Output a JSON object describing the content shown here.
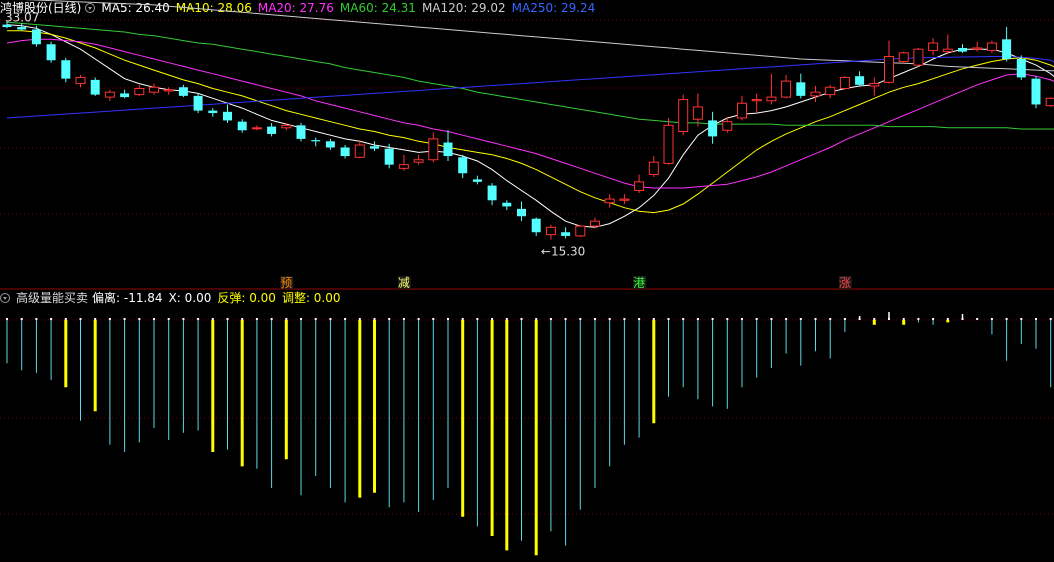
{
  "header": {
    "title": "鸿博股份(日线)",
    "ma": [
      {
        "label": "MA5: 26.40",
        "color": "#ffffff"
      },
      {
        "label": "MA10: 28.06",
        "color": "#ffff00"
      },
      {
        "label": "MA20: 27.76",
        "color": "#ff33ff"
      },
      {
        "label": "MA60: 24.31",
        "color": "#33cc33"
      },
      {
        "label": "MA120: 29.02",
        "color": "#cccccc"
      },
      {
        "label": "MA250: 29.24",
        "color": "#3333ff"
      }
    ]
  },
  "indicator": {
    "title": "高级量能买卖",
    "items": [
      {
        "label": "偏离: -11.84",
        "color": "#ffffff"
      },
      {
        "label": "X: 0.00",
        "color": "#ffffff"
      },
      {
        "label": "反弹: 0.00",
        "color": "#ffff00"
      },
      {
        "label": "调整: 0.00",
        "color": "#ffff00"
      }
    ]
  },
  "signals": [
    {
      "label": "预",
      "index": 19,
      "color": "#ff8800"
    },
    {
      "label": "减",
      "index": 27,
      "color": "#ffff66"
    },
    {
      "label": "港",
      "index": 43,
      "color": "#33ff33"
    },
    {
      "label": "涨",
      "index": 57,
      "color": "#ff4444"
    }
  ],
  "chart_data": {
    "type": "candlestick",
    "price_range": [
      12.5,
      33.5
    ],
    "annotations": [
      {
        "text": "33.07",
        "index": 0,
        "value": 33.07
      },
      {
        "text": "←15.30",
        "index": 37,
        "value": 15.3
      }
    ],
    "candles": [
      [
        32.8,
        33.07,
        32.5,
        32.6
      ],
      [
        32.6,
        32.9,
        32.3,
        32.4
      ],
      [
        32.4,
        32.7,
        31.0,
        31.2
      ],
      [
        31.2,
        31.4,
        29.7,
        29.9
      ],
      [
        29.9,
        30.1,
        28.1,
        28.4
      ],
      [
        28.0,
        28.7,
        27.7,
        28.5
      ],
      [
        28.3,
        28.5,
        27.0,
        27.1
      ],
      [
        26.9,
        27.5,
        26.6,
        27.3
      ],
      [
        27.2,
        27.5,
        26.8,
        26.9
      ],
      [
        27.1,
        27.9,
        27.0,
        27.6
      ],
      [
        27.3,
        28.0,
        27.1,
        27.7
      ],
      [
        27.4,
        27.7,
        27.1,
        27.5
      ],
      [
        27.7,
        27.9,
        26.9,
        27.0
      ],
      [
        27.0,
        27.2,
        25.6,
        25.8
      ],
      [
        25.8,
        26.0,
        25.3,
        25.6
      ],
      [
        25.7,
        26.3,
        24.8,
        25.0
      ],
      [
        24.9,
        25.1,
        24.0,
        24.2
      ],
      [
        24.4,
        24.6,
        24.2,
        24.4
      ],
      [
        24.5,
        24.8,
        23.7,
        23.9
      ],
      [
        24.4,
        24.8,
        24.2,
        24.6
      ],
      [
        24.6,
        24.8,
        23.3,
        23.5
      ],
      [
        23.4,
        23.6,
        22.9,
        23.3
      ],
      [
        23.3,
        23.5,
        22.6,
        22.8
      ],
      [
        22.8,
        23.0,
        21.9,
        22.1
      ],
      [
        22.0,
        23.4,
        21.9,
        23.0
      ],
      [
        22.9,
        23.3,
        22.5,
        22.7
      ],
      [
        22.7,
        23.1,
        21.1,
        21.4
      ],
      [
        21.1,
        22.2,
        20.9,
        21.4
      ],
      [
        21.6,
        22.2,
        21.4,
        21.8
      ],
      [
        21.8,
        24.0,
        21.6,
        23.5
      ],
      [
        23.2,
        24.2,
        21.7,
        22.1
      ],
      [
        22.0,
        22.2,
        20.3,
        20.7
      ],
      [
        20.2,
        20.5,
        19.8,
        20.0
      ],
      [
        19.7,
        19.9,
        18.1,
        18.5
      ],
      [
        18.3,
        18.5,
        17.7,
        18.0
      ],
      [
        17.8,
        18.4,
        16.8,
        17.2
      ],
      [
        17.0,
        17.1,
        15.6,
        15.9
      ],
      [
        15.7,
        16.5,
        15.3,
        16.3
      ],
      [
        15.9,
        16.3,
        15.4,
        15.6
      ],
      [
        15.6,
        16.5,
        15.5,
        16.4
      ],
      [
        16.4,
        17.1,
        16.2,
        16.8
      ],
      [
        18.3,
        19.0,
        17.9,
        18.6
      ],
      [
        18.5,
        19.0,
        18.2,
        18.6
      ],
      [
        19.3,
        20.6,
        19.1,
        20.0
      ],
      [
        20.6,
        22.1,
        20.4,
        21.6
      ],
      [
        21.5,
        25.2,
        21.4,
        24.6
      ],
      [
        24.1,
        27.1,
        23.8,
        26.7
      ],
      [
        25.1,
        27.2,
        24.5,
        26.1
      ],
      [
        25.0,
        25.7,
        23.1,
        23.7
      ],
      [
        24.2,
        25.3,
        24.0,
        24.9
      ],
      [
        25.2,
        27.0,
        25.0,
        26.4
      ],
      [
        26.6,
        27.2,
        25.6,
        26.7
      ],
      [
        26.6,
        28.8,
        26.3,
        26.9
      ],
      [
        26.9,
        28.7,
        26.8,
        28.2
      ],
      [
        28.1,
        28.8,
        26.8,
        27.0
      ],
      [
        27.0,
        27.8,
        26.5,
        27.3
      ],
      [
        27.1,
        27.9,
        26.8,
        27.7
      ],
      [
        27.6,
        28.6,
        27.5,
        28.5
      ],
      [
        28.6,
        29.0,
        27.8,
        27.9
      ],
      [
        27.8,
        28.5,
        27.0,
        28.0
      ],
      [
        28.1,
        31.5,
        28.0,
        30.2
      ],
      [
        29.8,
        30.6,
        29.6,
        30.5
      ],
      [
        29.5,
        30.9,
        29.4,
        30.8
      ],
      [
        30.7,
        31.7,
        30.3,
        31.3
      ],
      [
        30.6,
        32.0,
        30.4,
        30.8
      ],
      [
        30.9,
        31.2,
        30.5,
        30.6
      ],
      [
        30.8,
        31.4,
        30.6,
        30.9
      ],
      [
        30.7,
        31.5,
        30.5,
        31.3
      ],
      [
        31.6,
        32.6,
        29.8,
        30.0
      ],
      [
        30.0,
        30.3,
        28.3,
        28.5
      ],
      [
        28.4,
        28.6,
        26.0,
        26.3
      ],
      [
        26.2,
        26.9,
        26.1,
        26.8
      ],
      [
        26.3,
        26.8,
        25.9,
        26.5
      ]
    ],
    "ma": [
      {
        "name": "MA5",
        "color": "#ffffff",
        "values": [
          32.8,
          32.7,
          32.5,
          32.0,
          31.4,
          30.8,
          30.0,
          29.2,
          28.4,
          28.0,
          27.7,
          27.5,
          27.4,
          27.2,
          26.8,
          26.4,
          26.0,
          25.5,
          25.0,
          24.7,
          24.4,
          24.1,
          23.8,
          23.5,
          23.3,
          23.0,
          22.8,
          22.6,
          22.4,
          22.5,
          22.4,
          22.1,
          21.7,
          21.0,
          20.1,
          19.3,
          18.5,
          17.6,
          16.8,
          16.4,
          16.3,
          16.6,
          17.2,
          17.9,
          18.9,
          20.3,
          22.2,
          23.8,
          24.6,
          25.2,
          25.5,
          25.6,
          25.8,
          26.1,
          26.5,
          26.9,
          27.3,
          27.6,
          27.8,
          27.9,
          28.4,
          28.9,
          29.4,
          30.0,
          30.5,
          30.8,
          30.8,
          30.8,
          30.5,
          30.0,
          29.5,
          28.8,
          27.8
        ]
      },
      {
        "name": "MA10",
        "color": "#ffff00",
        "values": [
          32.3,
          32.3,
          32.2,
          32.0,
          31.7,
          31.3,
          30.9,
          30.4,
          29.9,
          29.5,
          29.1,
          28.7,
          28.3,
          28.0,
          27.6,
          27.3,
          27.0,
          26.6,
          26.2,
          25.8,
          25.5,
          25.2,
          24.9,
          24.6,
          24.3,
          24.1,
          23.8,
          23.6,
          23.3,
          23.1,
          22.8,
          22.6,
          22.4,
          22.2,
          21.9,
          21.5,
          21.0,
          20.4,
          19.8,
          19.2,
          18.7,
          18.3,
          17.9,
          17.6,
          17.5,
          17.7,
          18.2,
          19.0,
          19.9,
          20.8,
          21.7,
          22.6,
          23.3,
          23.9,
          24.4,
          24.9,
          25.3,
          25.8,
          26.3,
          26.8,
          27.3,
          27.7,
          28.0,
          28.4,
          28.8,
          29.2,
          29.5,
          29.8,
          30.0,
          30.1,
          29.9,
          29.5,
          28.9
        ]
      },
      {
        "name": "MA20",
        "color": "#ff33ff",
        "values": [
          31.3,
          31.5,
          31.6,
          31.6,
          31.5,
          31.4,
          31.2,
          30.9,
          30.6,
          30.3,
          30.0,
          29.7,
          29.4,
          29.1,
          28.8,
          28.5,
          28.2,
          27.9,
          27.6,
          27.3,
          27.0,
          26.6,
          26.3,
          26.0,
          25.7,
          25.4,
          25.1,
          24.8,
          24.6,
          24.3,
          24.1,
          23.8,
          23.5,
          23.2,
          22.9,
          22.6,
          22.3,
          21.9,
          21.5,
          21.1,
          20.7,
          20.3,
          19.9,
          19.6,
          19.5,
          19.5,
          19.5,
          19.6,
          19.7,
          19.8,
          20.1,
          20.4,
          20.8,
          21.3,
          21.8,
          22.3,
          22.8,
          23.4,
          23.9,
          24.4,
          24.9,
          25.4,
          25.9,
          26.4,
          26.9,
          27.4,
          27.9,
          28.3,
          28.7,
          28.8,
          28.6,
          28.3,
          27.8
        ]
      },
      {
        "name": "MA60",
        "color": "#33cc33",
        "values": [
          33.0,
          32.9,
          32.8,
          32.7,
          32.6,
          32.5,
          32.4,
          32.3,
          32.2,
          32.0,
          31.9,
          31.7,
          31.5,
          31.3,
          31.2,
          31.0,
          30.8,
          30.6,
          30.4,
          30.2,
          30.0,
          29.8,
          29.6,
          29.3,
          29.1,
          28.9,
          28.7,
          28.5,
          28.2,
          28.0,
          27.8,
          27.6,
          27.3,
          27.1,
          26.9,
          26.7,
          26.5,
          26.3,
          26.1,
          25.9,
          25.7,
          25.5,
          25.3,
          25.1,
          25.0,
          24.9,
          24.8,
          24.8,
          24.7,
          24.7,
          24.7,
          24.7,
          24.7,
          24.6,
          24.6,
          24.6,
          24.6,
          24.6,
          24.6,
          24.6,
          24.5,
          24.5,
          24.5,
          24.5,
          24.4,
          24.4,
          24.4,
          24.4,
          24.4,
          24.3,
          24.3,
          24.3,
          24.31
        ]
      },
      {
        "name": "MA120",
        "color": "#cccccc",
        "values": [
          34.9,
          34.85,
          34.8,
          34.75,
          34.7,
          34.65,
          34.6,
          34.55,
          34.5,
          34.45,
          34.4,
          34.3,
          34.2,
          34.1,
          34.0,
          33.9,
          33.8,
          33.7,
          33.6,
          33.5,
          33.4,
          33.3,
          33.2,
          33.1,
          33.0,
          32.9,
          32.8,
          32.7,
          32.6,
          32.5,
          32.4,
          32.3,
          32.2,
          32.1,
          32.0,
          31.9,
          31.8,
          31.7,
          31.6,
          31.5,
          31.4,
          31.3,
          31.2,
          31.1,
          31.0,
          30.9,
          30.8,
          30.7,
          30.6,
          30.5,
          30.4,
          30.3,
          30.2,
          30.1,
          30.0,
          29.95,
          29.9,
          29.85,
          29.8,
          29.75,
          29.7,
          29.65,
          29.6,
          29.5,
          29.4,
          29.35,
          29.3,
          29.25,
          29.2,
          29.15,
          29.1,
          29.05,
          29.02
        ]
      },
      {
        "name": "MA250",
        "color": "#3333ff",
        "values": [
          25.2,
          25.28,
          25.36,
          25.44,
          25.52,
          25.6,
          25.68,
          25.76,
          25.84,
          25.92,
          26.0,
          26.08,
          26.16,
          26.24,
          26.32,
          26.4,
          26.48,
          26.56,
          26.64,
          26.72,
          26.8,
          26.88,
          26.96,
          27.04,
          27.12,
          27.2,
          27.28,
          27.36,
          27.44,
          27.52,
          27.6,
          27.68,
          27.76,
          27.84,
          27.92,
          28.0,
          28.08,
          28.16,
          28.24,
          28.32,
          28.4,
          28.48,
          28.56,
          28.64,
          28.72,
          28.8,
          28.88,
          28.96,
          29.04,
          29.12,
          29.2,
          29.28,
          29.36,
          29.44,
          29.52,
          29.6,
          29.68,
          29.76,
          29.84,
          29.92,
          30.0,
          30.05,
          30.1,
          30.12,
          30.14,
          30.16,
          30.18,
          30.2,
          30.2,
          30.15,
          30.05,
          29.9,
          29.24
        ]
      }
    ],
    "indicator": {
      "range": [
        -1.0,
        0.05
      ],
      "values": [
        -0.18,
        -0.21,
        -0.22,
        -0.25,
        -0.28,
        -0.42,
        -0.38,
        -0.52,
        -0.55,
        -0.51,
        -0.45,
        -0.5,
        -0.47,
        -0.46,
        -0.55,
        -0.54,
        -0.61,
        -0.62,
        -0.7,
        -0.58,
        -0.73,
        -0.65,
        -0.7,
        -0.76,
        -0.74,
        -0.72,
        -0.78,
        -0.76,
        -0.8,
        -0.75,
        -0.7,
        -0.82,
        -0.86,
        -0.9,
        -0.96,
        -0.92,
        -0.98,
        -0.88,
        -0.94,
        -0.79,
        -0.7,
        -0.61,
        -0.52,
        -0.49,
        -0.43,
        -0.32,
        -0.28,
        -0.33,
        -0.36,
        -0.37,
        -0.28,
        -0.24,
        -0.2,
        -0.14,
        -0.19,
        -0.13,
        -0.16,
        -0.05,
        0.02,
        -0.02,
        0.04,
        -0.02,
        -0.01,
        -0.02,
        -0.01,
        0.03,
        0.01,
        -0.06,
        -0.17,
        -0.1,
        -0.12,
        -0.28,
        -0.22
      ],
      "yellow": [
        4,
        6,
        14,
        16,
        19,
        24,
        25,
        31,
        33,
        34,
        36,
        44,
        59,
        61,
        64
      ]
    }
  }
}
